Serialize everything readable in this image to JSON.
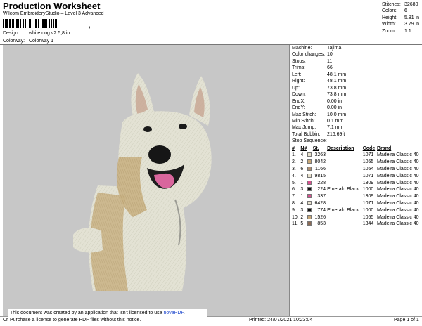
{
  "header": {
    "title": "Production Worksheet",
    "subtitle": "Wilcom EmbroideryStudio – Level 3 Advanced",
    "barcode_suffix": ",",
    "design_label": "Design:",
    "design_value": "white dog v2 5,8 in",
    "colorway_label": "Colorway:",
    "colorway_value": "Colorway 1"
  },
  "stats": {
    "stitches_label": "Stitches:",
    "stitches": "32680",
    "colors_label": "Colors:",
    "colors": "6",
    "height_label": "Height:",
    "height": "5.81 in",
    "width_label": "Width:",
    "width": "3.79 in",
    "zoom_label": "Zoom:",
    "zoom": "1:1"
  },
  "machine": {
    "rows": [
      {
        "label": "Machine:",
        "value": "Tajima"
      },
      {
        "label": "Color changes:",
        "value": "10"
      },
      {
        "label": "Stops:",
        "value": "11"
      },
      {
        "label": "Trims:",
        "value": "66"
      },
      {
        "label": "Left:",
        "value": "48.1 mm"
      },
      {
        "label": "Right:",
        "value": "48.1 mm"
      },
      {
        "label": "Up:",
        "value": "73.8 mm"
      },
      {
        "label": "Down:",
        "value": "73.8 mm"
      },
      {
        "label": "EndX:",
        "value": "0.00 in"
      },
      {
        "label": "EndY:",
        "value": "0.00 in"
      },
      {
        "label": "Max Stitch:",
        "value": "10.0 mm"
      },
      {
        "label": "Min Stitch:",
        "value": "0.1 mm"
      },
      {
        "label": "Max Jump:",
        "value": "7.1 mm"
      },
      {
        "label": "Total Bobbin:",
        "value": "216.69ft"
      }
    ]
  },
  "sequence": {
    "title": "Stop Sequence:",
    "headers": {
      "num": "#",
      "n": "N#",
      "st": "St.",
      "desc": "Description",
      "code": "Code",
      "brand": "Brand"
    },
    "rows": [
      {
        "num": "1.",
        "n": "4",
        "color": "#e8e1cc",
        "st": "3263",
        "desc": "",
        "code": "1071",
        "brand": "Madeira Classic 40"
      },
      {
        "num": "2.",
        "n": "2",
        "color": "#c8a877",
        "st": "8042",
        "desc": "",
        "code": "1055",
        "brand": "Madeira Classic 40"
      },
      {
        "num": "3.",
        "n": "6",
        "color": "#ae8f73",
        "st": "1166",
        "desc": "",
        "code": "1054",
        "brand": "Madeira Classic 40"
      },
      {
        "num": "4.",
        "n": "4",
        "color": "#e8e1cc",
        "st": "9815",
        "desc": "",
        "code": "1071",
        "brand": "Madeira Classic 40"
      },
      {
        "num": "5.",
        "n": "1",
        "color": "#d94f90",
        "st": "228",
        "desc": "",
        "code": "1309",
        "brand": "Madeira Classic 40"
      },
      {
        "num": "6.",
        "n": "3",
        "color": "#111111",
        "st": "224",
        "desc": "Emerald Black",
        "code": "1000",
        "brand": "Madeira Classic 40"
      },
      {
        "num": "7.",
        "n": "1",
        "color": "#d94f90",
        "st": "337",
        "desc": "",
        "code": "1309",
        "brand": "Madeira Classic 40"
      },
      {
        "num": "8.",
        "n": "4",
        "color": "#e8e1cc",
        "st": "6428",
        "desc": "",
        "code": "1071",
        "brand": "Madeira Classic 40"
      },
      {
        "num": "9.",
        "n": "3",
        "color": "#111111",
        "st": "774",
        "desc": "Emerald Black",
        "code": "1000",
        "brand": "Madeira Classic 40"
      },
      {
        "num": "10.",
        "n": "2",
        "color": "#c8a877",
        "st": "1526",
        "desc": "",
        "code": "1055",
        "brand": "Madeira Classic 40"
      },
      {
        "num": "11.",
        "n": "5",
        "color": "#8c6b55",
        "st": "853",
        "desc": "",
        "code": "1344",
        "brand": "Madeira Classic 40"
      }
    ]
  },
  "footer": {
    "left": "Cr",
    "notice_line1": "This document was created by an application that isn't licensed to use ",
    "notice_link": "novaPDF",
    "notice_line1_end": ".",
    "notice_line2": "Purchase a license to generate PDF files without this notice.",
    "printed": "Printed: 24/07/2021 10:23:04",
    "page": "Page 1 of 1"
  },
  "colors": {
    "canvas_bg": "#c7c7c7",
    "dog_fur": "#e3e2d4",
    "dog_tan": "#c9b284",
    "tongue": "#d9669d"
  }
}
